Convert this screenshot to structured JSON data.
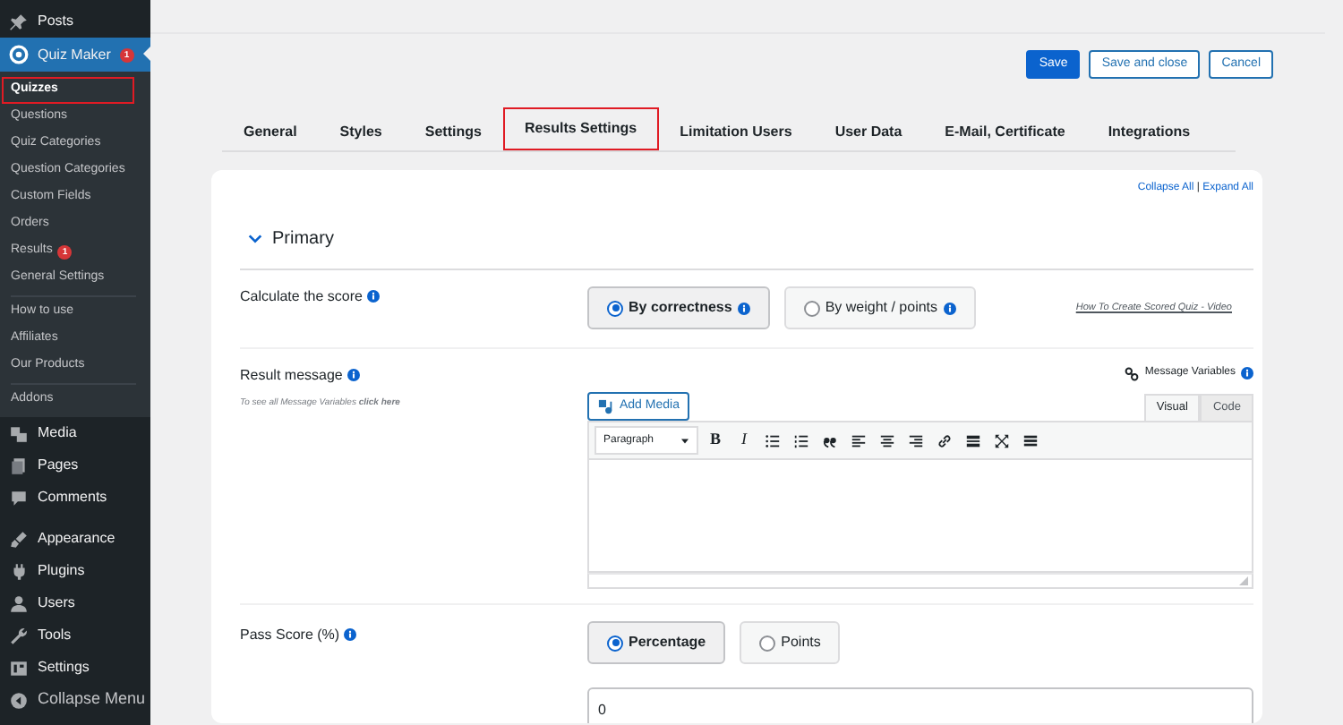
{
  "sidebar": {
    "top": [
      {
        "label": "Posts"
      }
    ],
    "plugin": {
      "label": "Quiz Maker",
      "badge": "1",
      "selected": true
    },
    "submenu": [
      [
        {
          "label": "Quizzes",
          "selected": true
        },
        {
          "label": "Questions",
          "selected": false
        },
        {
          "label": "Quiz Categories",
          "selected": false
        },
        {
          "label": "Question Categories",
          "selected": false
        },
        {
          "label": "Custom Fields",
          "selected": false
        },
        {
          "label": "Orders",
          "selected": false
        },
        {
          "label": "Results",
          "selected": false,
          "badge": "1"
        },
        {
          "label": "General Settings",
          "selected": false
        }
      ],
      [
        {
          "label": "How to use",
          "selected": false
        },
        {
          "label": "Affiliates",
          "selected": false
        },
        {
          "label": "Our Products",
          "selected": false
        }
      ],
      [
        {
          "label": "Addons",
          "selected": false
        }
      ]
    ],
    "menus": [
      [
        {
          "label": "Media"
        },
        {
          "label": "Pages"
        },
        {
          "label": "Comments"
        }
      ],
      [
        {
          "label": "Appearance"
        },
        {
          "label": "Plugins"
        },
        {
          "label": "Users"
        },
        {
          "label": "Tools"
        },
        {
          "label": "Settings"
        }
      ]
    ],
    "collapse": "Collapse Menu"
  },
  "actions": [
    {
      "label": "Save",
      "kind": "primary"
    },
    {
      "label": "Save and close",
      "kind": "outline"
    },
    {
      "label": "Cancel",
      "kind": "outline"
    }
  ],
  "tabs": [
    {
      "label": "General",
      "selected": false
    },
    {
      "label": "Styles",
      "selected": false
    },
    {
      "label": "Settings",
      "selected": false
    },
    {
      "label": "Results Settings",
      "selected": true
    },
    {
      "label": "Limitation Users",
      "selected": false
    },
    {
      "label": "User Data",
      "selected": false
    },
    {
      "label": "E-Mail, Certificate",
      "selected": false
    },
    {
      "label": "Integrations",
      "selected": false
    }
  ],
  "panel": {
    "collapse_all": "Collapse All",
    "separator": "|",
    "expand_all": "Expand All",
    "section": {
      "title": "Primary",
      "expanded": true
    },
    "score": {
      "label": "Calculate the score",
      "options": [
        {
          "label": "By correctness",
          "selected": true,
          "info": true
        },
        {
          "label": "By weight / points",
          "selected": false,
          "info": true
        }
      ],
      "video_link": "How To Create Scored Quiz - Video"
    },
    "result_message": {
      "label": "Result message",
      "hint": "To see all Message Variables",
      "hint_link": "click here",
      "variables": "Message Variables",
      "add_media": "Add Media",
      "editor_tabs": [
        {
          "label": "Visual",
          "selected": true
        },
        {
          "label": "Code",
          "selected": false
        }
      ],
      "format": "Paragraph",
      "toolbar": [
        {
          "kind": "char",
          "label": "B"
        },
        {
          "kind": "char",
          "label": "I"
        },
        {
          "kind": "bullets"
        },
        {
          "kind": "numbers"
        },
        {
          "kind": "quote"
        },
        {
          "kind": "align-left"
        },
        {
          "kind": "align-center"
        },
        {
          "kind": "align-right"
        },
        {
          "kind": "link"
        },
        {
          "kind": "more"
        },
        {
          "kind": "fullscreen"
        },
        {
          "kind": "toolbar"
        }
      ]
    },
    "pass_score": {
      "label": "Pass Score (%)",
      "options": [
        {
          "label": "Percentage",
          "selected": true,
          "info": false
        },
        {
          "label": "Points",
          "selected": false,
          "info": false
        }
      ],
      "value": "0"
    }
  }
}
